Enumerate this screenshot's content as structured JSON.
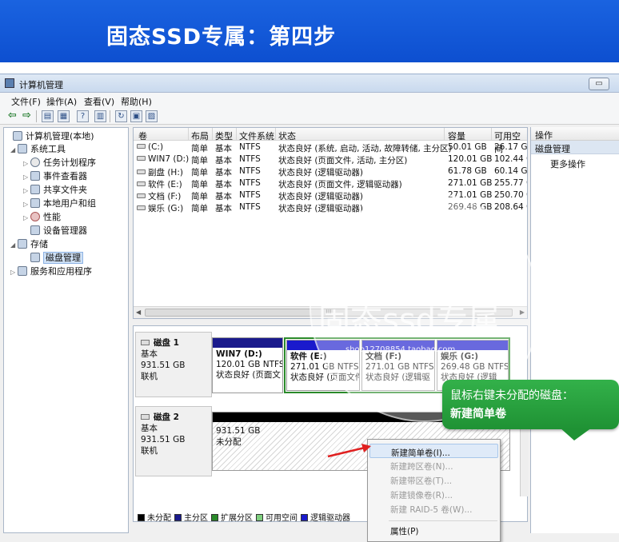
{
  "banner": {
    "title": "固态SSD专属：第四步"
  },
  "window": {
    "title": "计算机管理"
  },
  "menu": [
    "文件(F)",
    "操作(A)",
    "查看(V)",
    "帮助(H)"
  ],
  "tree": [
    {
      "label": "计算机管理(本地)",
      "exp": "",
      "depth": 0,
      "icon": "computer-management-icon"
    },
    {
      "label": "系统工具",
      "exp": "◢",
      "depth": 1,
      "icon": "system-tools-icon"
    },
    {
      "label": "任务计划程序",
      "exp": "▷",
      "depth": 2,
      "icon": "task-scheduler-icon"
    },
    {
      "label": "事件查看器",
      "exp": "▷",
      "depth": 2,
      "icon": "event-viewer-icon"
    },
    {
      "label": "共享文件夹",
      "exp": "▷",
      "depth": 2,
      "icon": "shared-folders-icon"
    },
    {
      "label": "本地用户和组",
      "exp": "▷",
      "depth": 2,
      "icon": "local-users-icon"
    },
    {
      "label": "性能",
      "exp": "▷",
      "depth": 2,
      "icon": "performance-icon"
    },
    {
      "label": "设备管理器",
      "exp": "",
      "depth": 2,
      "icon": "device-manager-icon"
    },
    {
      "label": "存储",
      "exp": "◢",
      "depth": 1,
      "icon": "storage-icon"
    },
    {
      "label": "磁盘管理",
      "exp": "",
      "depth": 2,
      "icon": "disk-management-icon"
    },
    {
      "label": "服务和应用程序",
      "exp": "▷",
      "depth": 1,
      "icon": "services-icon"
    }
  ],
  "volumes": {
    "headers": [
      "卷",
      "布局",
      "类型",
      "文件系统",
      "状态",
      "容量",
      "可用空间"
    ],
    "rows": [
      [
        "(C:)",
        "简单",
        "基本",
        "NTFS",
        "状态良好 (系统, 启动, 活动, 故障转储, 主分区)",
        "50.01 GB",
        "26.17 GB"
      ],
      [
        "WIN7 (D:)",
        "简单",
        "基本",
        "NTFS",
        "状态良好 (页面文件, 活动, 主分区)",
        "120.01 GB",
        "102.44 GB"
      ],
      [
        "副盘 (H:)",
        "简单",
        "基本",
        "NTFS",
        "状态良好 (逻辑驱动器)",
        "61.78 GB",
        "60.14 GB"
      ],
      [
        "软件 (E:)",
        "简单",
        "基本",
        "NTFS",
        "状态良好 (页面文件, 逻辑驱动器)",
        "271.01 GB",
        "255.77 GB"
      ],
      [
        "文档 (F:)",
        "简单",
        "基本",
        "NTFS",
        "状态良好 (逻辑驱动器)",
        "271.01 GB",
        "250.70 GB"
      ],
      [
        "娱乐 (G:)",
        "简单",
        "基本",
        "NTFS",
        "状态良好 (逻辑驱动器)",
        "269.48 GB",
        "208.64 GB"
      ]
    ],
    "scroll_mark": "III"
  },
  "actions": {
    "header": "操作",
    "section": "磁盘管理",
    "more": "更多操作"
  },
  "disk1": {
    "name": "磁盘 1",
    "type": "基本",
    "size": "931.51 GB",
    "status": "联机",
    "partitions": [
      {
        "name": "WIN7  (D:)",
        "size": "120.01 GB NTFS",
        "status": "状态良好 (页面文"
      },
      {
        "name": "软件  (E:)",
        "size": "271.01 GB NTFS",
        "status": "状态良好 (页面文件"
      },
      {
        "name": "文档  (F:)",
        "size": "271.01 GB NTFS",
        "status": "状态良好 (逻辑驱"
      },
      {
        "name": "娱乐  (G:)",
        "size": "269.48 GB NTFS",
        "status": "状态良好 (逻辑"
      }
    ]
  },
  "disk2": {
    "name": "磁盘 2",
    "type": "基本",
    "size": "931.51 GB",
    "status": "联机",
    "unalloc_size": "931.51 GB",
    "unalloc_label": "未分配"
  },
  "legend": [
    {
      "label": "未分配",
      "color": "#000000"
    },
    {
      "label": "主分区",
      "color": "#1a1a8c"
    },
    {
      "label": "扩展分区",
      "color": "#2a8a2a"
    },
    {
      "label": "可用空间",
      "color": "#7fd07f"
    },
    {
      "label": "逻辑驱动器",
      "color": "#1a1acc"
    }
  ],
  "context_menu": [
    {
      "label": "新建简单卷(I)...",
      "enabled": true
    },
    {
      "label": "新建跨区卷(N)...",
      "enabled": false
    },
    {
      "label": "新建带区卷(T)...",
      "enabled": false
    },
    {
      "label": "新建镜像卷(R)...",
      "enabled": false
    },
    {
      "label": "新建 RAID-5 卷(W)...",
      "enabled": false
    },
    {
      "label": "属性(P)",
      "enabled": true
    }
  ],
  "callout": {
    "line1": "鼠标右键未分配的磁盘：",
    "line2": "新建简单卷"
  },
  "watermark": {
    "line1": "盗图必究",
    "line2": "固态ssd专属",
    "line3": "shop12708854.taobao.com"
  },
  "colors": {
    "banner": "#1a63e0",
    "callout": "#2aa040",
    "arrow": "#e02020",
    "logical_drive": "#1a1acc",
    "extended": "#2a8a2a"
  }
}
